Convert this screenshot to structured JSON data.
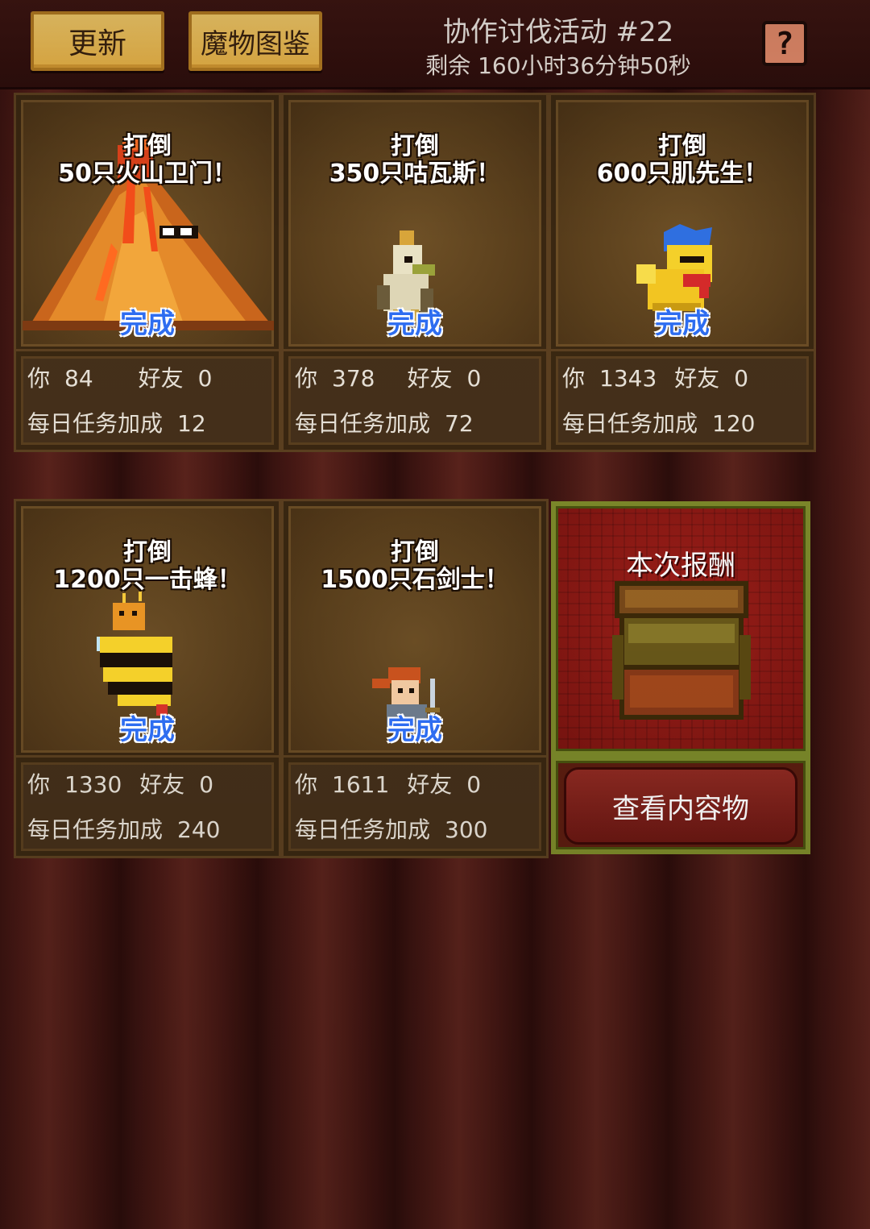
{
  "header": {
    "update_label": "更新",
    "bestiary_label": "魔物图鉴",
    "event_title": "协作讨伐活动 #22",
    "remaining": "剩余 160小时36分钟50秒",
    "help_label": "?"
  },
  "cards": [
    {
      "line1": "打倒",
      "line2": "50只火山卫门！",
      "status": "完成",
      "you_label": "你",
      "you": "84",
      "friend_label": "好友",
      "friend": "0",
      "bonus_label": "每日任务加成",
      "bonus": "12",
      "sprite": "volcano-monster"
    },
    {
      "line1": "打倒",
      "line2": "350只咕瓦斯！",
      "status": "完成",
      "you_label": "你",
      "you": "378",
      "friend_label": "好友",
      "friend": "0",
      "bonus_label": "每日任务加成",
      "bonus": "72",
      "sprite": "bird-monster"
    },
    {
      "line1": "打倒",
      "line2": "600只肌先生！",
      "status": "完成",
      "you_label": "你",
      "you": "1343",
      "friend_label": "好友",
      "friend": "0",
      "bonus_label": "每日任务加成",
      "bonus": "120",
      "sprite": "yellow-duck-monster"
    },
    {
      "line1": "打倒",
      "line2": "1200只一击蜂！",
      "status": "完成",
      "you_label": "你",
      "you": "1330",
      "friend_label": "好友",
      "friend": "0",
      "bonus_label": "每日任务加成",
      "bonus": "240",
      "sprite": "bee-monster"
    },
    {
      "line1": "打倒",
      "line2": "1500只石剑士！",
      "status": "完成",
      "you_label": "你",
      "you": "1611",
      "friend_label": "好友",
      "friend": "0",
      "bonus_label": "每日任务加成",
      "bonus": "300",
      "sprite": "swordsman-monster"
    }
  ],
  "reward": {
    "title": "本次报酬",
    "view_label": "查看内容物",
    "icon": "treasure-chest-icon"
  },
  "colors": {
    "status_blue": "#2e6df0",
    "button_yellow": "#f4c35a"
  }
}
